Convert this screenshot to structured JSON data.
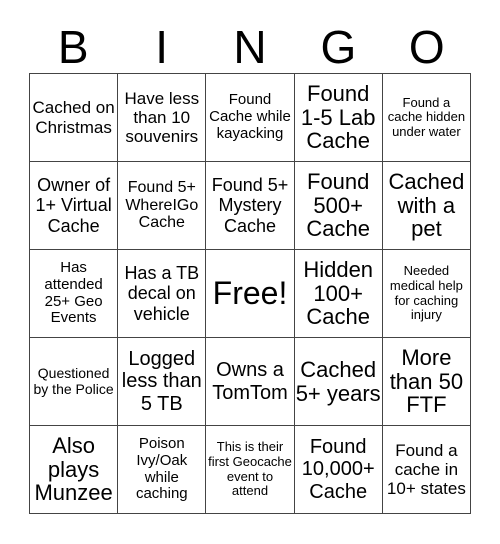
{
  "header": {
    "letters": [
      "B",
      "I",
      "N",
      "G",
      "O"
    ]
  },
  "cells": [
    [
      "Cached on Christmas",
      "Have less than 10 souvenirs",
      "Found Cache while kayacking",
      "Found 1-5 Lab Cache",
      "Found a cache hidden under water"
    ],
    [
      "Owner of 1+ Virtual Cache",
      "Found 5+ WhereIGo Cache",
      "Found 5+ Mystery Cache",
      "Found 500+ Cache",
      "Cached with a pet"
    ],
    [
      "Has attended 25+ Geo Events",
      "Has a TB decal on vehicle",
      "Free!",
      "Hidden 100+ Cache",
      "Needed medical help for caching injury"
    ],
    [
      "Questioned by the Police",
      "Logged less than 5 TB",
      "Owns a TomTom",
      "Cached 5+ years",
      "More than 50 FTF"
    ],
    [
      "Also plays Munzee",
      "Poison Ivy/Oak while caching",
      "This is their first Geocache event to attend",
      "Found 10,000+ Cache",
      "Found a cache in 10+ states"
    ]
  ]
}
